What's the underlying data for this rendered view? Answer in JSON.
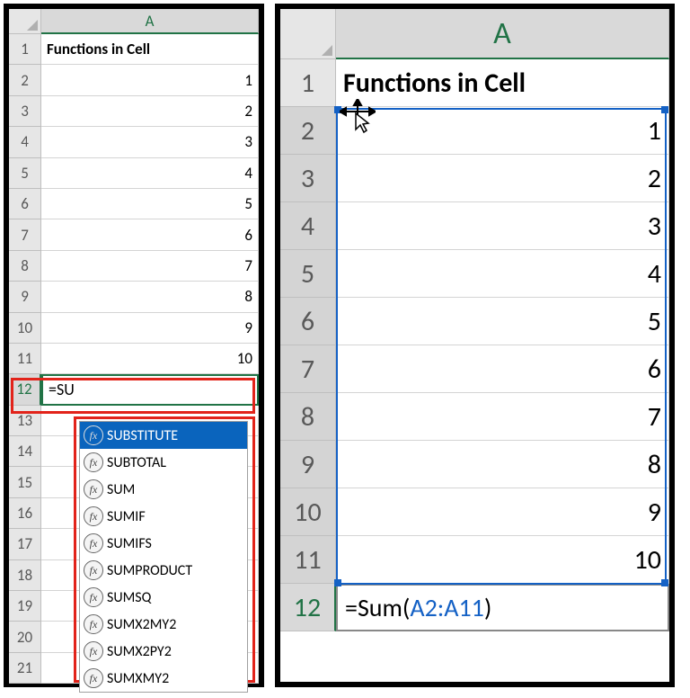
{
  "left": {
    "col_label": "A",
    "header_text": "Functions in Cell",
    "rows": [
      {
        "n": "1"
      },
      {
        "n": "2",
        "v": "1"
      },
      {
        "n": "3",
        "v": "2"
      },
      {
        "n": "4",
        "v": "3"
      },
      {
        "n": "5",
        "v": "4"
      },
      {
        "n": "6",
        "v": "5"
      },
      {
        "n": "7",
        "v": "6"
      },
      {
        "n": "8",
        "v": "7"
      },
      {
        "n": "9",
        "v": "8"
      },
      {
        "n": "10",
        "v": "9"
      },
      {
        "n": "11",
        "v": "10"
      },
      {
        "n": "12"
      },
      {
        "n": "13"
      },
      {
        "n": "14"
      },
      {
        "n": "15"
      },
      {
        "n": "16"
      },
      {
        "n": "17"
      },
      {
        "n": "18"
      },
      {
        "n": "19"
      },
      {
        "n": "20"
      },
      {
        "n": "21"
      }
    ],
    "editing_value": "=SU",
    "autocomplete": [
      "SUBSTITUTE",
      "SUBTOTAL",
      "SUM",
      "SUMIF",
      "SUMIFS",
      "SUMPRODUCT",
      "SUMSQ",
      "SUMX2MY2",
      "SUMX2PY2",
      "SUMXMY2"
    ]
  },
  "right": {
    "col_label": "A",
    "header_text": "Functions in Cell",
    "rows": [
      {
        "n": "1"
      },
      {
        "n": "2",
        "v": "1"
      },
      {
        "n": "3",
        "v": "2"
      },
      {
        "n": "4",
        "v": "3"
      },
      {
        "n": "5",
        "v": "4"
      },
      {
        "n": "6",
        "v": "5"
      },
      {
        "n": "7",
        "v": "6"
      },
      {
        "n": "8",
        "v": "7"
      },
      {
        "n": "9",
        "v": "8"
      },
      {
        "n": "10",
        "v": "9"
      },
      {
        "n": "11",
        "v": "10"
      }
    ],
    "formula_prefix": "=Sum(",
    "formula_ref": "A2:A11",
    "formula_suffix": ")",
    "formula_row": "12"
  }
}
